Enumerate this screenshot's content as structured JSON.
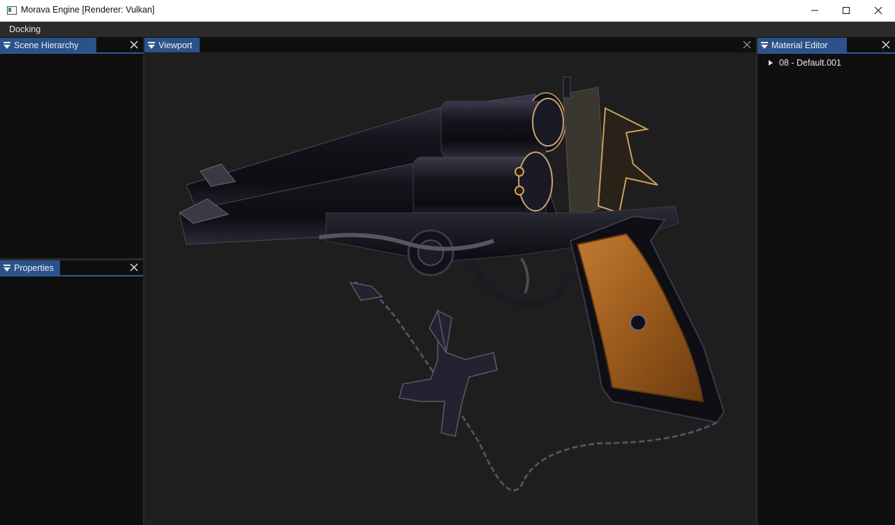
{
  "window": {
    "title": "Morava Engine [Renderer: Vulkan]"
  },
  "menubar": {
    "items": [
      "Docking"
    ]
  },
  "panels": {
    "scene_hierarchy": {
      "title": "Scene Hierarchy"
    },
    "properties": {
      "title": "Properties"
    },
    "viewport": {
      "title": "Viewport"
    },
    "material_editor": {
      "title": "Material Editor",
      "items": [
        "08 - Default.001"
      ]
    }
  },
  "colors": {
    "tab_active": "#2b5289",
    "tab_underline": "#2d5a96",
    "panel_bg": "#0f0f0f",
    "viewport_bg": "#1e1e1e",
    "menubar_bg": "#2b2b2b",
    "grip_wood": "#9a5a1c",
    "gun_metal": "#1a1a24"
  },
  "icons": [
    "app-icon",
    "minimize-icon",
    "maximize-icon",
    "close-icon",
    "panel-menu-icon",
    "panel-close-icon",
    "tree-expand-icon"
  ]
}
